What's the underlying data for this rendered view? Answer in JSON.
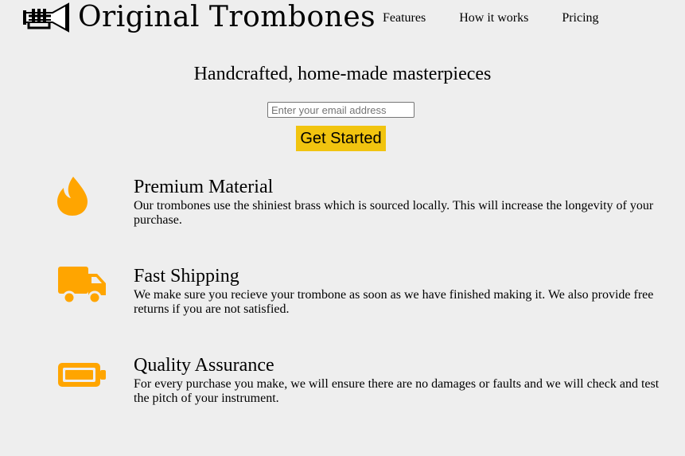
{
  "brand": {
    "name": "Original Trombones",
    "logo_icon": "trumpet-icon"
  },
  "nav": {
    "items": [
      {
        "label": "Features"
      },
      {
        "label": "How it works"
      },
      {
        "label": "Pricing"
      }
    ]
  },
  "hero": {
    "title": "Handcrafted, home-made masterpieces",
    "email_placeholder": "Enter your email address",
    "email_value": "",
    "cta_label": "Get Started"
  },
  "features": [
    {
      "icon": "fire-icon",
      "title": "Premium Material",
      "description": "Our trombones use the shiniest brass which is sourced locally. This will increase the longevity of your purchase."
    },
    {
      "icon": "truck-icon",
      "title": "Fast Shipping",
      "description": "We make sure you recieve your trombone as soon as we have finished making it. We also provide free returns if you are not satisfied."
    },
    {
      "icon": "battery-icon",
      "title": "Quality Assurance",
      "description": "For every purchase you make, we will ensure there are no damages or faults and we will check and test the pitch of your instrument."
    }
  ],
  "colors": {
    "background": "#eeeeee",
    "accent": "#f1c40f",
    "icon": "#ffa500"
  }
}
